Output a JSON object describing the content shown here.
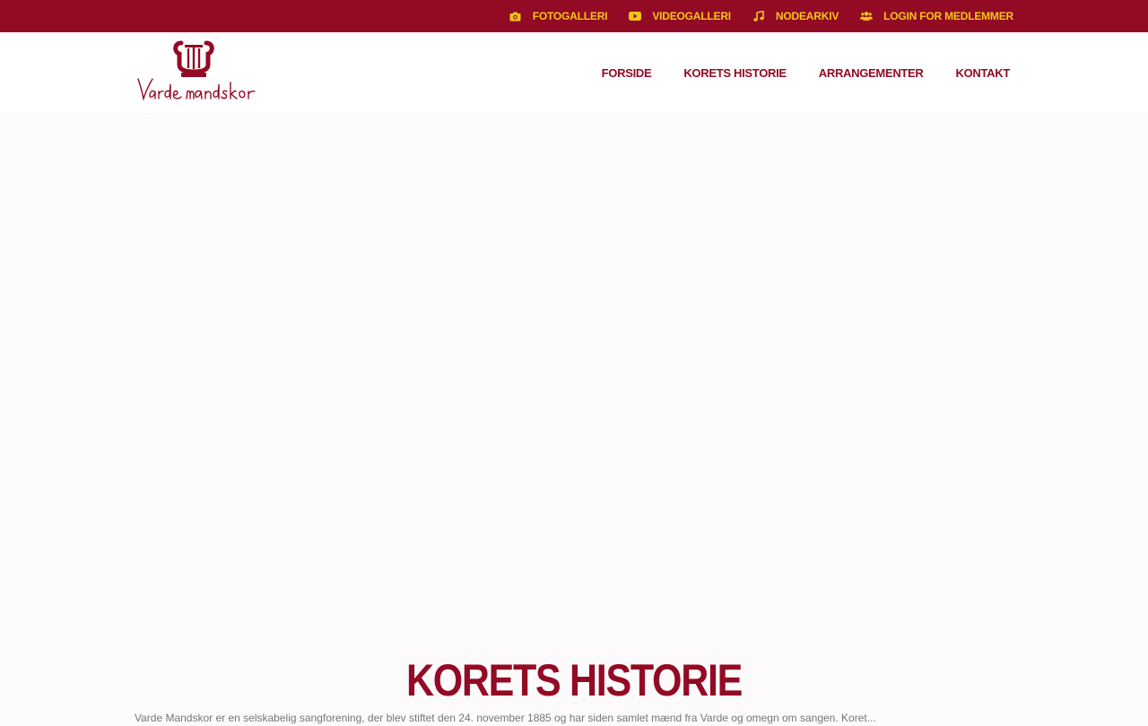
{
  "topbar": {
    "links": [
      {
        "label": "FOTOGALLERI",
        "icon": "camera-icon"
      },
      {
        "label": "VIDEOGALLERI",
        "icon": "youtube-icon"
      },
      {
        "label": "NODEARKIV",
        "icon": "music-note-icon"
      },
      {
        "label": "LOGIN FOR MEDLEMMER",
        "icon": "users-icon"
      }
    ]
  },
  "header": {
    "logo_text": "Varde mandskor",
    "nav": [
      {
        "label": "FORSIDE"
      },
      {
        "label": "KORETS HISTORIE"
      },
      {
        "label": "ARRANGEMENTER"
      },
      {
        "label": "KONTAKT"
      }
    ]
  },
  "main": {
    "title": "KORETS HISTORIE",
    "intro": "Varde Mandskor er en selskabelig sangforening, der blev stiftet den 24. november 1885 og har siden samlet mænd fra Varde og omegn om sangen. Koret..."
  },
  "colors": {
    "brand": "#930a24",
    "accent": "#f5c518",
    "background": "#fdfafb"
  }
}
